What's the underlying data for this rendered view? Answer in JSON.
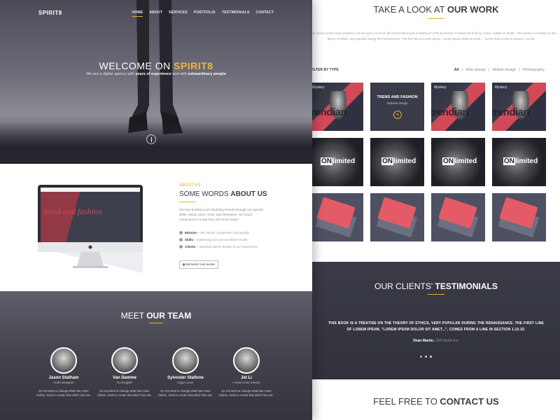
{
  "nav": {
    "brand": "SPIRIT8",
    "items": [
      {
        "label": "HOME",
        "active": true
      },
      {
        "label": "ABOUT",
        "active": false
      },
      {
        "label": "SERVICES",
        "active": false
      },
      {
        "label": "PORTFOLIO",
        "active": false
      },
      {
        "label": "TESTIMONIALS",
        "active": false
      },
      {
        "label": "CONTACT",
        "active": false
      }
    ]
  },
  "hero": {
    "welcome_plain": "WELCOME ON ",
    "welcome_bold": "SPIRIT8",
    "tagline_1": "We are a digital agency with ",
    "tagline_b1": "years of experience",
    "tagline_2": " and with ",
    "tagline_b2": "extraordinary people"
  },
  "about": {
    "label": "ABOUT US",
    "title_plain": "SOME WORDS ",
    "title_bold": "ABOUT US",
    "text": "We love building and rebuilding brands through our specific skills. Using colour, fonts, and illustration, we brand companies in a way they will never forget.",
    "screen_text": "trend and fashion",
    "list": [
      {
        "term": "Mission",
        "desc": "We deliver uniqueness and quality"
      },
      {
        "term": "Skills",
        "desc": "Delivering fast and excellent results"
      },
      {
        "term": "Clients",
        "desc": "Satisfied clients thanks to our experience"
      }
    ],
    "button": "BROWSE OUR WORK"
  },
  "team": {
    "title_plain": "MEET ",
    "title_bold": "OUR TEAM",
    "members": [
      {
        "name": "Jason Statham",
        "role": "Knife designer",
        "desc": "Do not seek to change what has come before. Seek to create that which has not."
      },
      {
        "name": "Van Damme",
        "role": "No English",
        "desc": "Do not seek to change what has come before. Seek to create that which has not."
      },
      {
        "name": "Sylvester Stallone",
        "role": "Cigar Lover",
        "desc": "Do not seek to change what has come before. Seek to create that which has not."
      },
      {
        "name": "Jet Li",
        "role": "I need more money",
        "desc": "Do not seek to change what has come before. Seek to create that which has not."
      }
    ]
  },
  "work": {
    "title_plain": "TAKE A LOOK AT ",
    "title_bold": "OUR WORK",
    "desc": "Lorem Ipsum comes from sections 1.10.32 and 1.10.33 of \"de Finibus Bonorum et Malorum\" (The Extremes of Good and Evil) by Cicero, written in 45 BC. This book is a treatise on the theory of ethics, very popular during the Renaissance. The first line of Lorem Ipsum, \"Lorem ipsum dolor sit amet..\", comes from a line in section 1.10.32.",
    "filter_label": "FILTER BY TYPE",
    "filters": [
      {
        "label": "All",
        "active": true
      },
      {
        "label": "Web design",
        "active": false
      },
      {
        "label": "Mobile design",
        "active": false
      },
      {
        "label": "Photography",
        "active": false
      }
    ],
    "tile_tag": "Mystery",
    "tile_big": "trendian",
    "feature_title": "TREND AND FASHION",
    "feature_sub": "Website design",
    "feature_plus": "+",
    "on_text": "ON",
    "limited_text": "limited"
  },
  "testimonials": {
    "title_plain": "OUR CLIENTS' ",
    "title_bold": "TESTIMONIALS",
    "quote": "THIS BOOK IS A TREATISE ON THE THEORY OF ETHICS, VERY POPULAR DURING THE RENAISSANCE. THE FIRST LINE OF LOREM IPSUM, \"LOREM IPSUM DOLOR SIT AMET...\", COMES FROM A LINE IN SECTION 1.10.32.",
    "author": "Dean Martin,",
    "author_role": " CEO Acme Inc."
  },
  "contact": {
    "title_plain": "FEEL FREE TO ",
    "title_bold": "CONTACT US"
  },
  "colors": {
    "accent": "#e8a93a",
    "dark": "#3a3c48",
    "tile_red": "#d04a58"
  }
}
